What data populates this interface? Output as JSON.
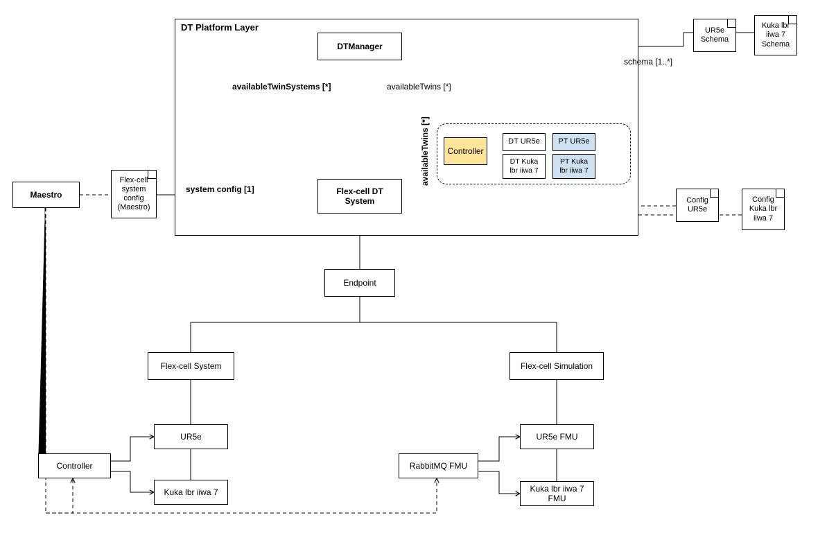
{
  "layer": {
    "title": "DT Platform Layer"
  },
  "nodes": {
    "dtmanager": "DTManager",
    "flexcell_dt_system": "Flex-cell DT System",
    "endpoint": "Endpoint",
    "maestro": "Maestro",
    "flexcell_config_note": "Flex-cell system config (Maestro)",
    "controller_inner": "Controller",
    "dt_ur5e": "DT UR5e",
    "pt_ur5e": "PT UR5e",
    "dt_kuka": "DT Kuka lbr iiwa 7",
    "pt_kuka": "PT Kuka lbr iiwa 7",
    "ur5e_schema": "UR5e Schema",
    "kuka_schema": "Kuka lbr iiwa 7 Schema",
    "config_ur5e": "Config UR5e",
    "config_kuka": "Config Kuka lbr iiwa 7",
    "flexcell_system": "Flex-cell System",
    "flexcell_simulation": "Flex-cell Simulation",
    "ur5e": "UR5e",
    "kuka": "Kuka lbr iiwa 7",
    "ur5e_fmu": "UR5e FMU",
    "kuka_fmu": "Kuka lbr iiwa 7 FMU",
    "controller": "Controller",
    "rabbitmq_fmu": "RabbitMQ FMU"
  },
  "labels": {
    "availableTwinSystems": "availableTwinSystems [*]",
    "availableTwins_h": "availableTwins [*]",
    "availableTwins_v": "availableTwins [*]",
    "system_config": "system config [1]",
    "schema": "schema [1..*]"
  }
}
